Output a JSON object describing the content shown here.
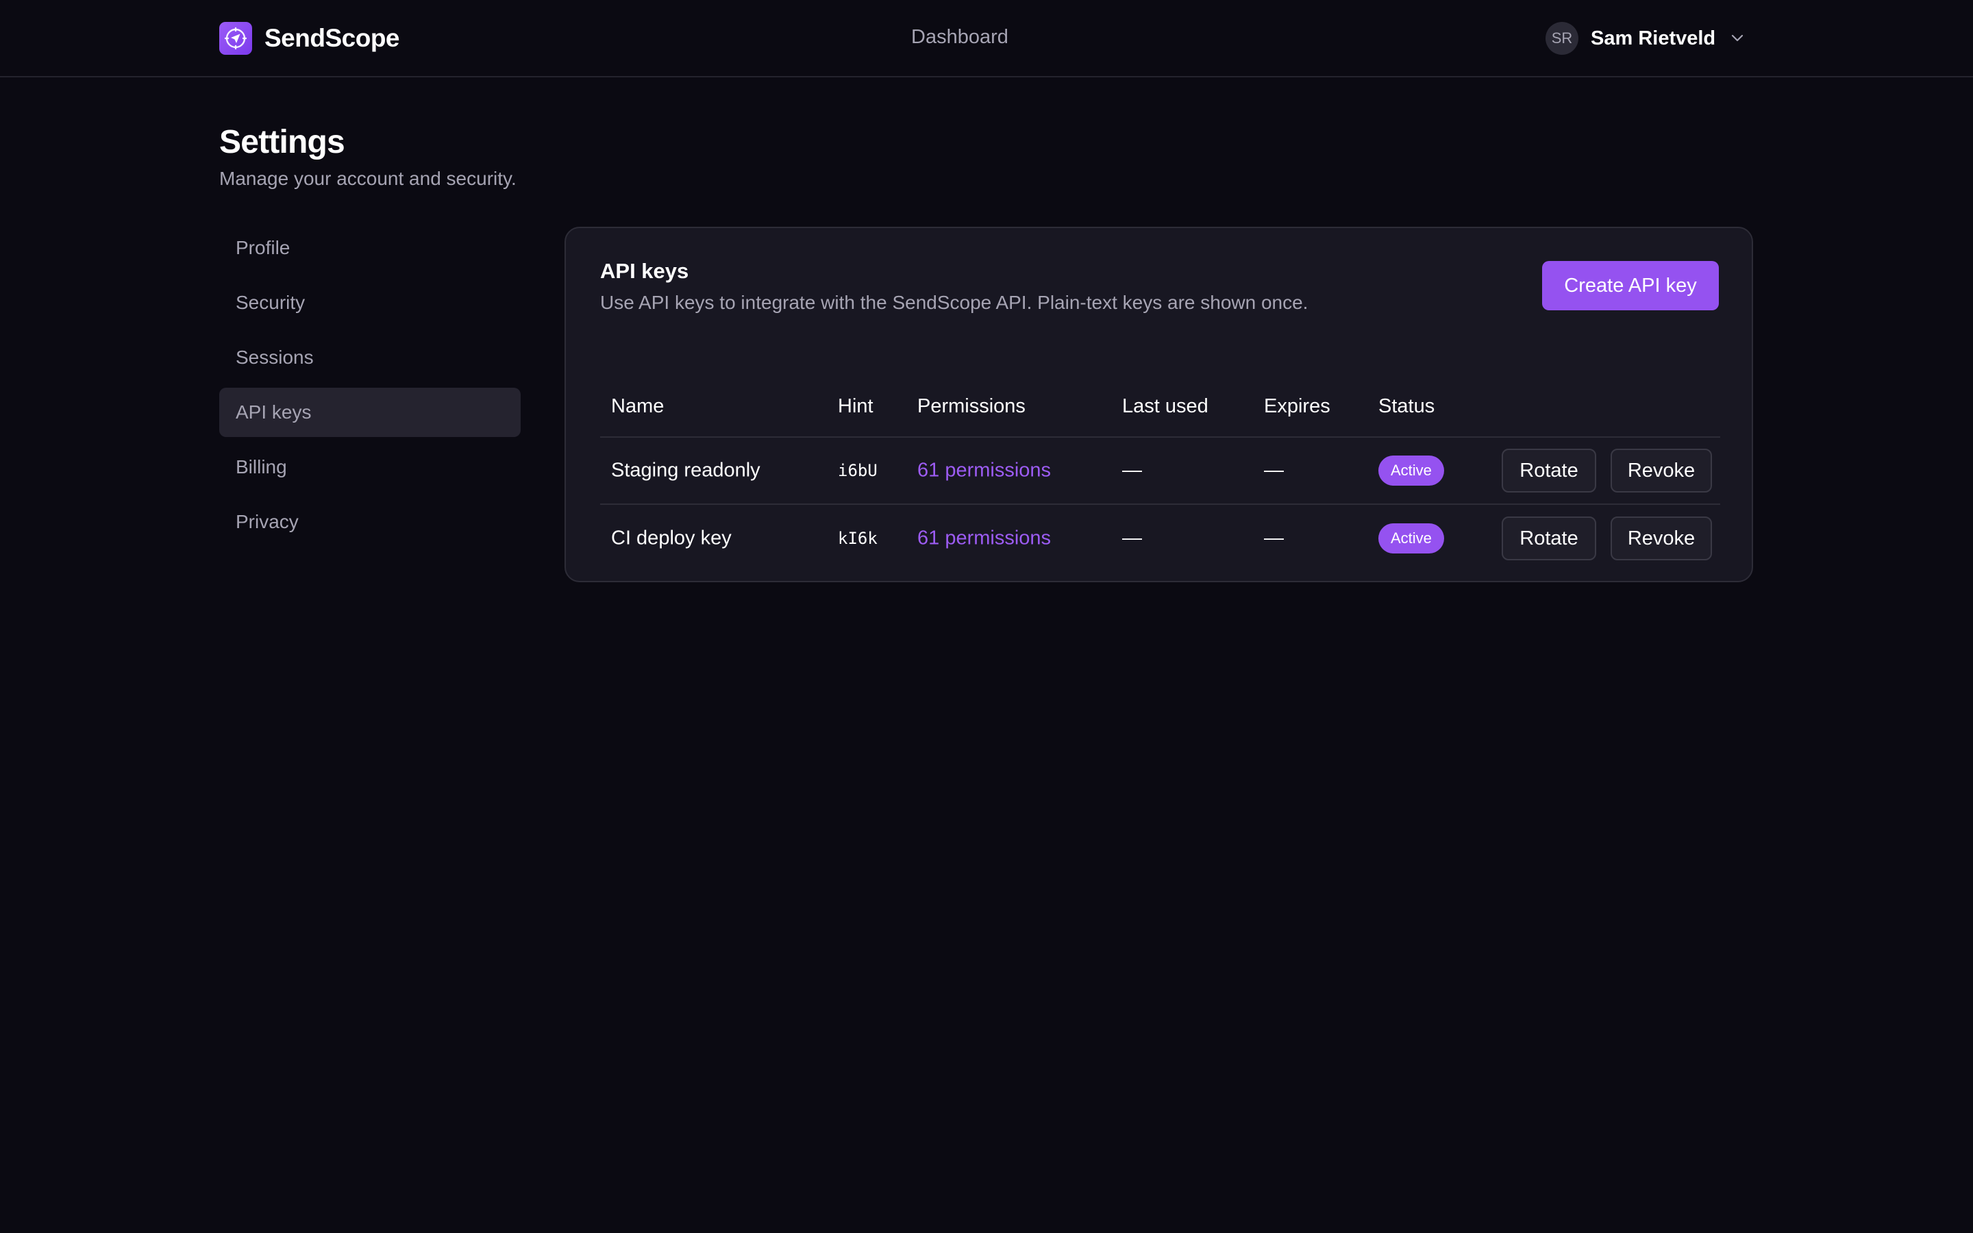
{
  "header": {
    "brand": "SendScope",
    "nav": {
      "dashboard": "Dashboard"
    },
    "user": {
      "initials": "SR",
      "name": "Sam Rietveld"
    }
  },
  "page": {
    "title": "Settings",
    "subtitle": "Manage your account and security."
  },
  "sidebar": {
    "items": [
      {
        "label": "Profile",
        "active": false
      },
      {
        "label": "Security",
        "active": false
      },
      {
        "label": "Sessions",
        "active": false
      },
      {
        "label": "API keys",
        "active": true
      },
      {
        "label": "Billing",
        "active": false
      },
      {
        "label": "Privacy",
        "active": false
      }
    ]
  },
  "api_keys": {
    "title": "API keys",
    "description": "Use API keys to integrate with the SendScope API. Plain-text keys are shown once.",
    "create_label": "Create API key",
    "columns": {
      "name": "Name",
      "hint": "Hint",
      "permissions": "Permissions",
      "last_used": "Last used",
      "expires": "Expires",
      "status": "Status"
    },
    "rows": [
      {
        "name": "Staging readonly",
        "hint": "i6bU",
        "permissions": "61 permissions",
        "last_used": "—",
        "expires": "—",
        "status": "Active",
        "rotate_label": "Rotate",
        "revoke_label": "Revoke"
      },
      {
        "name": "CI deploy key",
        "hint": "kI6k",
        "permissions": "61 permissions",
        "last_used": "—",
        "expires": "—",
        "status": "Active",
        "rotate_label": "Rotate",
        "revoke_label": "Revoke"
      }
    ]
  },
  "icons": {
    "logo": "send-compass-icon",
    "user_menu": "chevron-down-icon"
  },
  "colors": {
    "background": "#0b0a12",
    "card": "#181722",
    "accent": "#9552f0",
    "link": "#9d5cf4",
    "muted_text": "#a6a4b3"
  }
}
